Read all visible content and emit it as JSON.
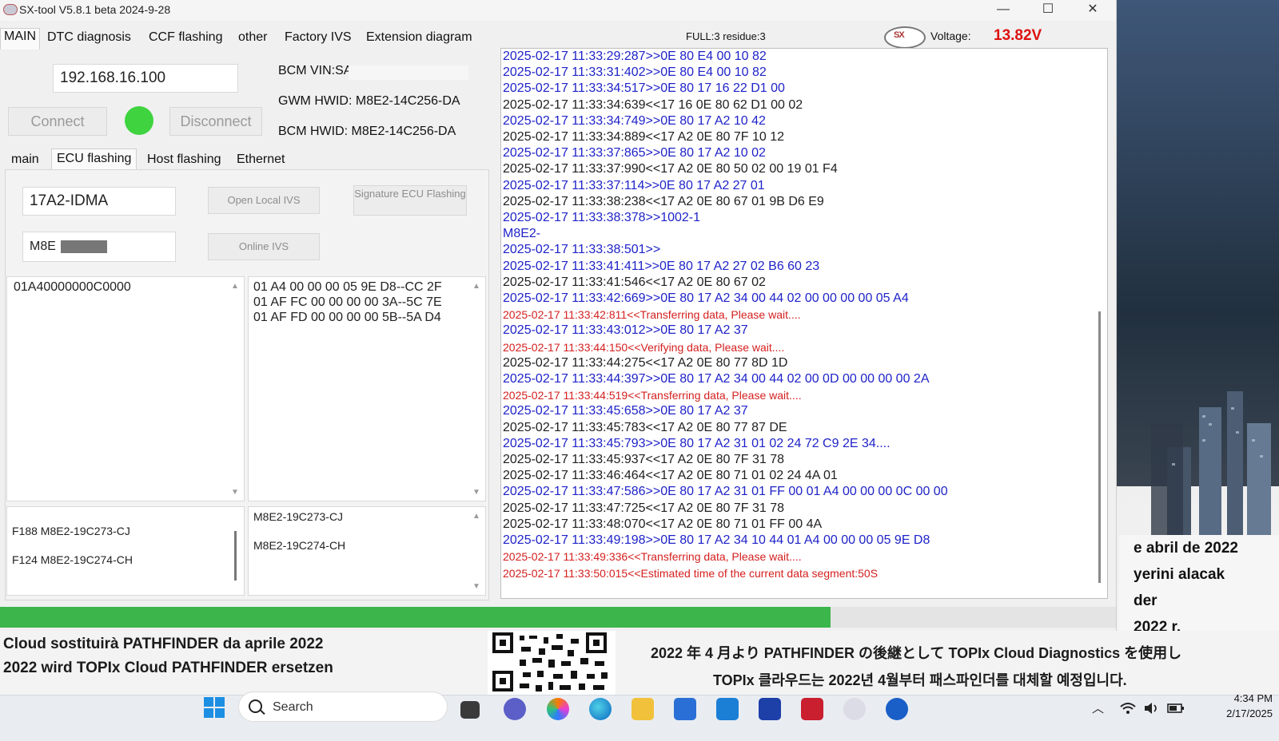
{
  "window": {
    "title": "SX-tool V5.8.1 beta 2024-9-28",
    "minimize_glyph": "—",
    "maximize_glyph": "☐",
    "close_glyph": "✕"
  },
  "tabs": [
    "MAIN",
    "DTC diagnosis",
    "CCF flashing",
    "other",
    "Factory IVS",
    "Extension diagram"
  ],
  "status": {
    "full_info": "FULL:3 residue:3",
    "voltage_label": "Voltage:",
    "voltage_value": "13.82V"
  },
  "connection": {
    "ip": "192.168.16.100",
    "connect_label": "Connect",
    "disconnect_label": "Disconnect",
    "status_color": "#3fd33f"
  },
  "vehicle": {
    "bcm_vin": "BCM VIN:SA",
    "gwm_hwid": "GWM HWID: M8E2-14C256-DA",
    "bcm_hwid": "BCM HWID: M8E2-14C256-DA"
  },
  "subtabs": [
    "main",
    "ECU flashing",
    "Host flashing",
    "Ethernet"
  ],
  "ecu": {
    "ecu_name": "17A2-IDMA",
    "part_field": "M8E",
    "open_local_ivs": "Open Local IVS",
    "signature_flashing": "Signature ECU Flashing",
    "online_ivs": "Online IVS"
  },
  "lists": {
    "address_list": [
      "01A40000000C0000"
    ],
    "data_list": [
      "01 A4 00 00 00 05 9E D8--CC 2F",
      "01 AF FC 00 00 00 00 3A--5C 7E",
      "01 AF FD 00 00 00 00 5B--5A D4"
    ],
    "did_list": [
      "F188  M8E2-19C273-CJ",
      "F124  M8E2-19C274-CH"
    ],
    "part_list": [
      "M8E2-19C273-CJ",
      "M8E2-19C274-CH"
    ]
  },
  "progress": {
    "fraction": 0.744
  },
  "log": [
    {
      "text": "2025-02-17 11:33:29:287>>0E 80 E4 00 10 82",
      "kind": "tx"
    },
    {
      "text": "2025-02-17 11:33:31:402>>0E 80 E4 00 10 82",
      "kind": "tx"
    },
    {
      "text": "2025-02-17 11:33:34:517>>0E 80 17 16 22 D1 00",
      "kind": "tx"
    },
    {
      "text": "2025-02-17 11:33:34:639<<17 16 0E 80 62 D1 00 02",
      "kind": "rx"
    },
    {
      "text": "2025-02-17 11:33:34:749>>0E 80 17 A2 10 42",
      "kind": "tx"
    },
    {
      "text": "2025-02-17 11:33:34:889<<17 A2 0E 80 7F 10 12",
      "kind": "rx"
    },
    {
      "text": "2025-02-17 11:33:37:865>>0E 80 17 A2 10 02",
      "kind": "tx"
    },
    {
      "text": "2025-02-17 11:33:37:990<<17 A2 0E 80 50 02 00 19 01 F4",
      "kind": "rx"
    },
    {
      "text": "2025-02-17 11:33:37:114>>0E 80 17 A2 27 01",
      "kind": "tx"
    },
    {
      "text": "2025-02-17 11:33:38:238<<17 A2 0E 80 67 01 9B D6 E9",
      "kind": "rx"
    },
    {
      "text": "2025-02-17 11:33:38:378>>1002-1",
      "kind": "tx"
    },
    {
      "text": "M8E2-",
      "kind": "tx"
    },
    {
      "text": "2025-02-17 11:33:38:501>>",
      "kind": "tx"
    },
    {
      "text": "2025-02-17 11:33:41:411>>0E 80 17 A2 27 02 B6 60 23",
      "kind": "tx"
    },
    {
      "text": "2025-02-17 11:33:41:546<<17 A2 0E 80 67 02",
      "kind": "rx"
    },
    {
      "text": "2025-02-17 11:33:42:669>>0E 80 17 A2 34 00 44 02 00 00 00 00 05 A4",
      "kind": "tx"
    },
    {
      "text": "2025-02-17 11:33:42:811<<Transferring data, Please wait....",
      "kind": "err"
    },
    {
      "text": "2025-02-17 11:33:43:012>>0E 80 17 A2 37",
      "kind": "tx"
    },
    {
      "text": "2025-02-17 11:33:44:150<<Verifying data, Please wait....",
      "kind": "err"
    },
    {
      "text": "2025-02-17 11:33:44:275<<17 A2 0E 80 77 8D 1D",
      "kind": "rx"
    },
    {
      "text": "2025-02-17 11:33:44:397>>0E 80 17 A2 34 00 44 02 00 0D 00 00 00 00 2A",
      "kind": "tx"
    },
    {
      "text": "2025-02-17 11:33:44:519<<Transferring data, Please wait....",
      "kind": "err"
    },
    {
      "text": "2025-02-17 11:33:45:658>>0E 80 17 A2 37",
      "kind": "tx"
    },
    {
      "text": "2025-02-17 11:33:45:783<<17 A2 0E 80 77 87 DE",
      "kind": "rx"
    },
    {
      "text": "2025-02-17 11:33:45:793>>0E 80 17 A2 31 01 02 24 72 C9 2E 34....",
      "kind": "tx"
    },
    {
      "text": "2025-02-17 11:33:45:937<<17 A2 0E 80 7F 31 78",
      "kind": "rx"
    },
    {
      "text": "2025-02-17 11:33:46:464<<17 A2 0E 80 71 01 02 24 4A 01",
      "kind": "rx"
    },
    {
      "text": "2025-02-17 11:33:47:586>>0E 80 17 A2 31 01 FF 00 01 A4 00 00 00 0C 00 00",
      "kind": "tx"
    },
    {
      "text": "2025-02-17 11:33:47:725<<17 A2 0E 80 7F 31 78",
      "kind": "rx"
    },
    {
      "text": "2025-02-17 11:33:48:070<<17 A2 0E 80 71 01 FF 00 4A",
      "kind": "rx"
    },
    {
      "text": "2025-02-17 11:33:49:198>>0E 80 17 A2 34 10 44 01 A4 00 00 00 05 9E D8",
      "kind": "tx"
    },
    {
      "text": "2025-02-17 11:33:49:336<<Transferring data, Please wait....",
      "kind": "err"
    },
    {
      "text": "2025-02-17 11:33:50:015<<Estimated time of the current data segment:50S",
      "kind": "err"
    }
  ],
  "banner": {
    "left_line1": "Cloud sostituirà PATHFINDER da aprile 2022",
    "left_line2": "2022 wird TOPIx Cloud PATHFINDER ersetzen",
    "right_line1": "2022 年 4 月より PATHFINDER の後継として TOPIx Cloud Diagnostics を使用し",
    "right_line2": "TOPIx 클라우드는 2022년 4월부터 패스파인더를 대체할 예정입니다."
  },
  "desktop_text": [
    "e abril de 2022",
    "yerini alacak",
    "der",
    "2022 r."
  ],
  "taskbar": {
    "search_placeholder": "Search",
    "time": "4:34 PM",
    "date": "2/17/2025"
  },
  "colors": {
    "tx": "#1f23c8",
    "rx": "#1f1f1f",
    "err": "#d51f1f",
    "voltage": "#d11111",
    "progress": "#3cb54a"
  }
}
